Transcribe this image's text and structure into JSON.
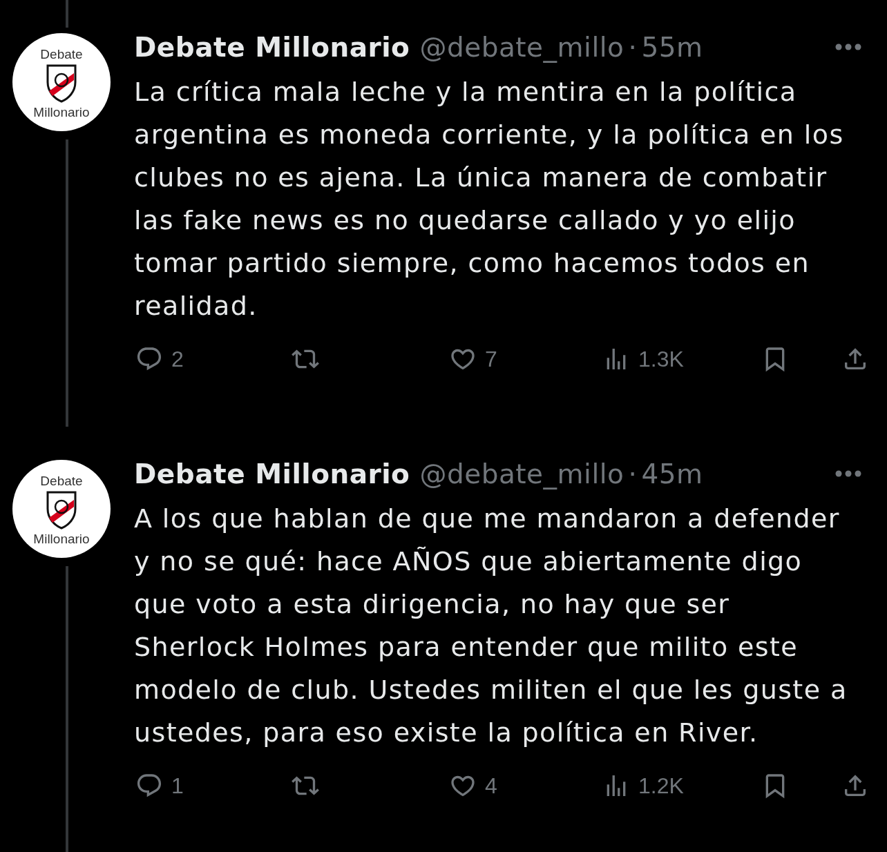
{
  "tweets": [
    {
      "connector_above": true,
      "avatar": {
        "top_text": "Debate",
        "bottom_text": "Millonario"
      },
      "name": "Debate Millonario",
      "handle": "@debate_millo",
      "separator": "·",
      "time": "55m",
      "text": "La crítica mala leche y la mentira en la política argentina es moneda corriente, y la política en los clubes no es ajena. La única manera de combatir las fake news es no quedarse callado y yo elijo tomar partido siempre, como hacemos todos en realidad.",
      "replies": "2",
      "likes": "7",
      "views": "1.3K"
    },
    {
      "connector_above": false,
      "avatar": {
        "top_text": "Debate",
        "bottom_text": "Millonario"
      },
      "name": "Debate Millonario",
      "handle": "@debate_millo",
      "separator": "·",
      "time": "45m",
      "text": "A los que hablan de que me mandaron a defender y no se qué: hace AÑOS que abiertamente digo que voto a esta dirigencia, no hay que ser Sherlock Holmes para entender que milito este modelo de club. Ustedes militen el que les guste a ustedes, para eso existe la política en River.",
      "replies": "1",
      "likes": "4",
      "views": "1.2K"
    }
  ]
}
